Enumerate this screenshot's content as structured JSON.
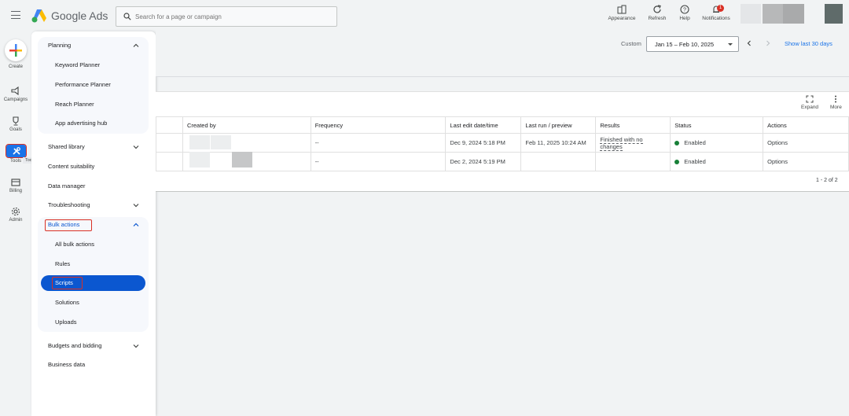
{
  "header": {
    "brand": "Google Ads",
    "search_placeholder": "Search for a page or campaign",
    "buttons": {
      "appearance": "Appearance",
      "refresh": "Refresh",
      "help": "Help",
      "notifications": "Notifications",
      "notification_count": "1"
    }
  },
  "rail": {
    "create": "Create",
    "campaigns": "Campaigns",
    "goals": "Goals",
    "tools": "Tools",
    "tools_tooltip": "Tools",
    "billing": "Billing",
    "admin": "Admin"
  },
  "menu": {
    "planning": "Planning",
    "keyword_planner": "Keyword Planner",
    "performance_planner": "Performance Planner",
    "reach_planner": "Reach Planner",
    "app_advertising_hub": "App advertising hub",
    "shared_library": "Shared library",
    "content_suitability": "Content suitability",
    "data_manager": "Data manager",
    "troubleshooting": "Troubleshooting",
    "bulk_actions": "Bulk actions",
    "all_bulk_actions": "All bulk actions",
    "rules": "Rules",
    "scripts": "Scripts",
    "solutions": "Solutions",
    "uploads": "Uploads",
    "budgets_and_bidding": "Budgets and bidding",
    "business_data": "Business data"
  },
  "date_range": {
    "label": "Custom",
    "value": "Jan 15 – Feb 10, 2025",
    "show_last": "Show last 30 days"
  },
  "panel": {
    "expand": "Expand",
    "more": "More"
  },
  "table": {
    "headers": {
      "created_by": "Created by",
      "frequency": "Frequency",
      "last_edit": "Last edit date/time",
      "last_run": "Last run / preview",
      "results": "Results",
      "status": "Status",
      "actions": "Actions"
    },
    "rows": [
      {
        "frequency": "--",
        "last_edit": "Dec 9, 2024 5:18 PM",
        "last_run": "Feb 11, 2025 10:24 AM",
        "results": "Finished with no changes",
        "status": "Enabled",
        "actions": "Options"
      },
      {
        "frequency": "--",
        "last_edit": "Dec 2, 2024 5:19 PM",
        "last_run": "",
        "results": "",
        "status": "Enabled",
        "actions": "Options"
      }
    ],
    "pagination": "1 - 2 of 2"
  },
  "colors": {
    "accent": "#1a73e8",
    "active_menu": "#0b57d0",
    "highlight_box": "#d93025",
    "status_enabled": "#188038"
  }
}
